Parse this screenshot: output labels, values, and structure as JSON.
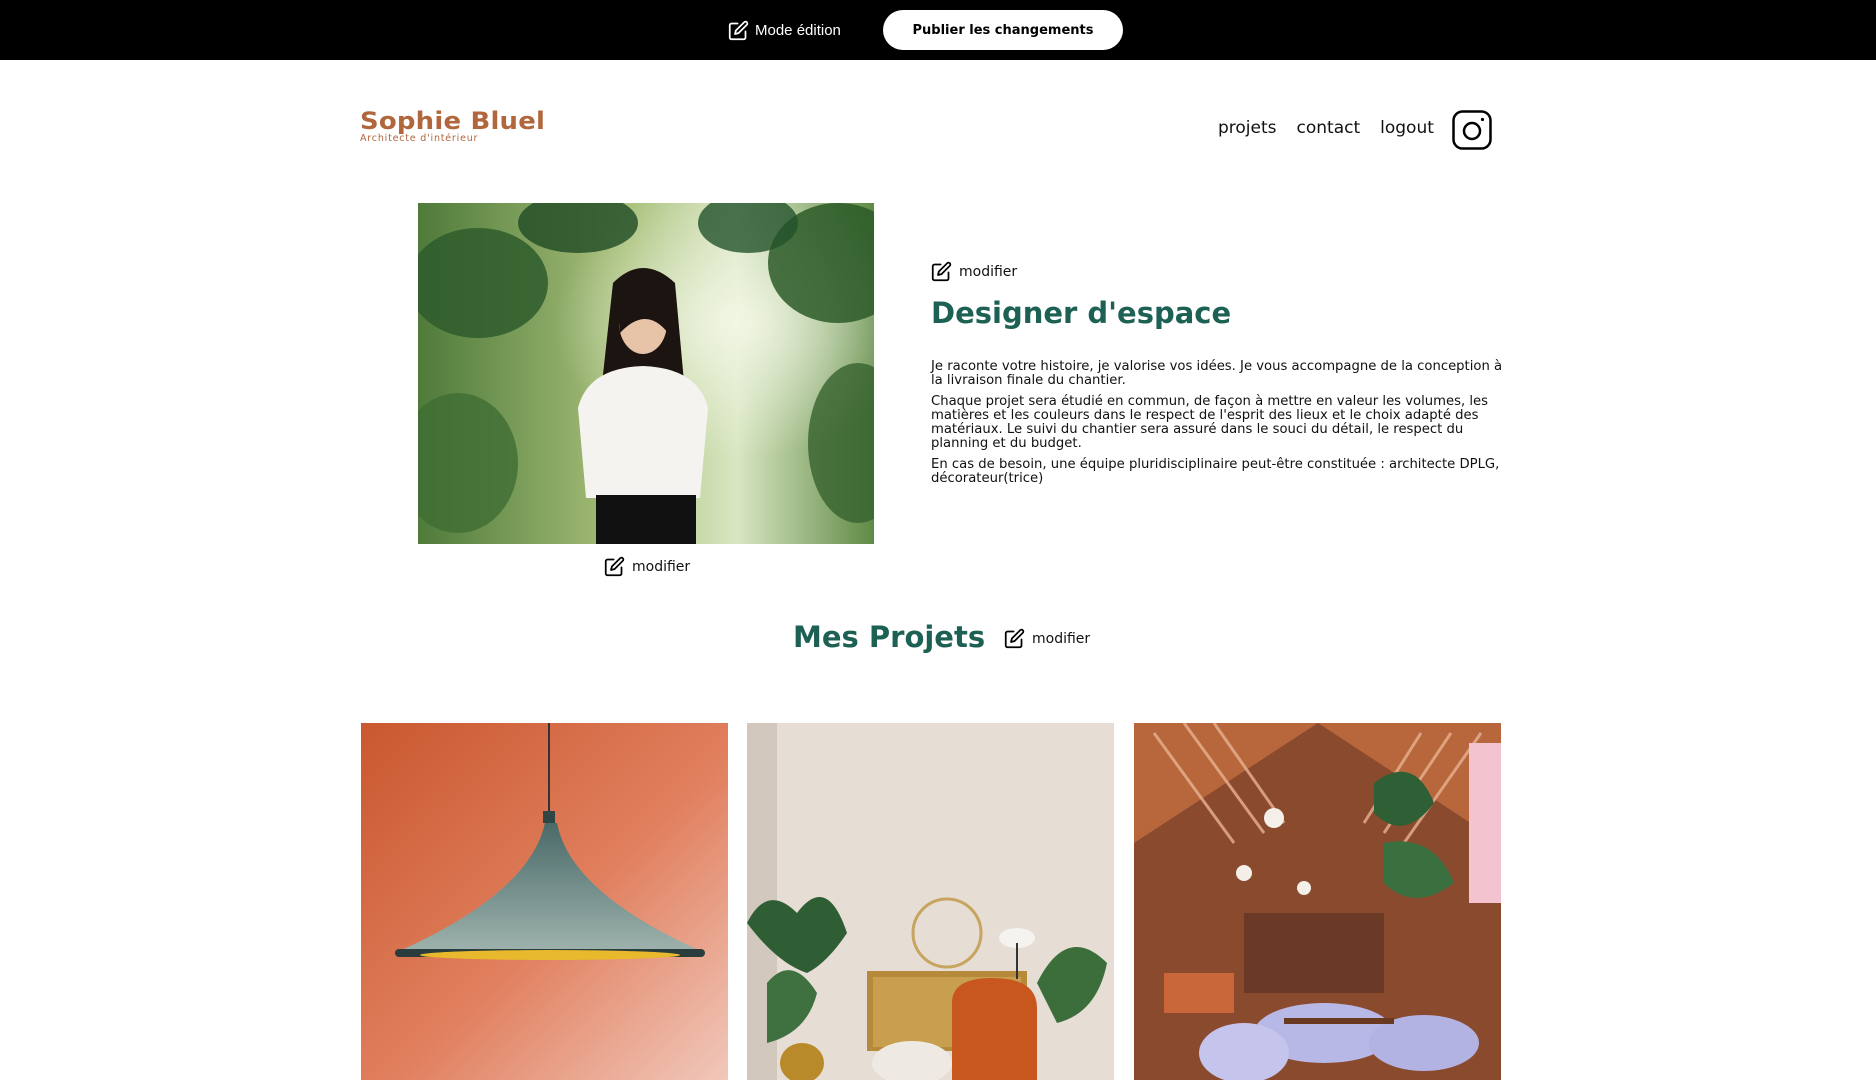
{
  "edit_bar": {
    "mode_label": "Mode édition",
    "publish_label": "Publier les changements"
  },
  "header": {
    "logo_title": "Sophie Bluel",
    "logo_subtitle": "Architecte d'intérieur",
    "nav": [
      "projets",
      "contact",
      "logout"
    ],
    "instagram_icon": "instagram-icon"
  },
  "intro": {
    "modifier_label": "modifier",
    "title": "Designer d'espace",
    "paragraphs": [
      "Je raconte votre histoire, je valorise vos idées. Je vous accompagne de la conception à la livraison finale du chantier.",
      "Chaque projet sera étudié en commun, de façon à mettre en valeur les volumes, les matières et les couleurs dans le respect de l'esprit des lieux et le choix adapté des matériaux. Le suivi du chantier sera assuré dans le souci du détail, le respect du planning et du budget.",
      "En cas de besoin, une équipe pluridisciplinaire peut-être constituée : architecte DPLG, décorateur(trice)"
    ],
    "portrait_modifier_label": "modifier"
  },
  "projects": {
    "title": "Mes Projets",
    "modifier_label": "modifier"
  },
  "colors": {
    "brand": "#B1663C",
    "title_green": "#1D6154",
    "edit_bar": "#000000"
  }
}
